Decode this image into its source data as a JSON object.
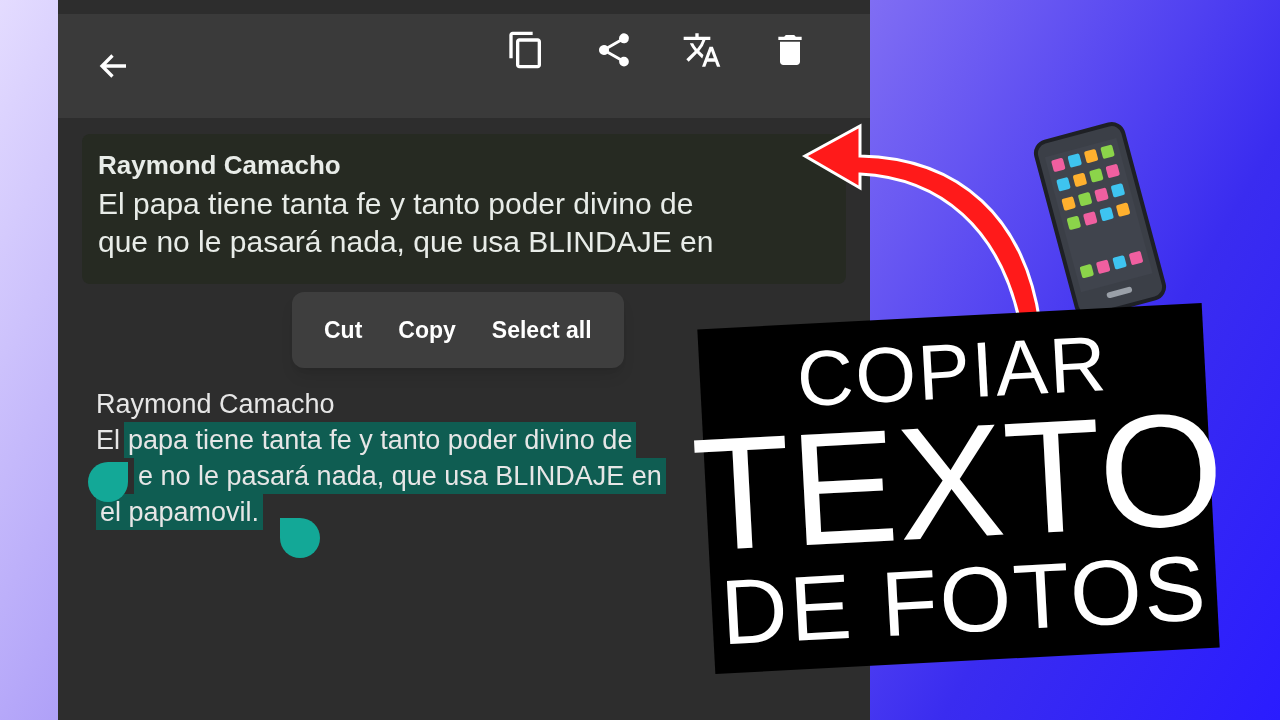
{
  "card": {
    "author": "Raymond Camacho",
    "lines": [
      "El papa tiene tanta fe y tanto poder divino de",
      "que no le pasará nada, que usa BLINDAJE en"
    ]
  },
  "menu": [
    "Cut",
    "Copy",
    "Select all"
  ],
  "message": {
    "author": "Raymond Camacho",
    "lead": "El",
    "selected_lines": [
      "papa tiene tanta fe y tanto poder divino de",
      "e no le pasará nada, que usa BLINDAJE en",
      "el papamovil."
    ]
  },
  "title": {
    "lines": [
      "COPIAR",
      "TEXTO",
      "DE FOTOS"
    ]
  }
}
